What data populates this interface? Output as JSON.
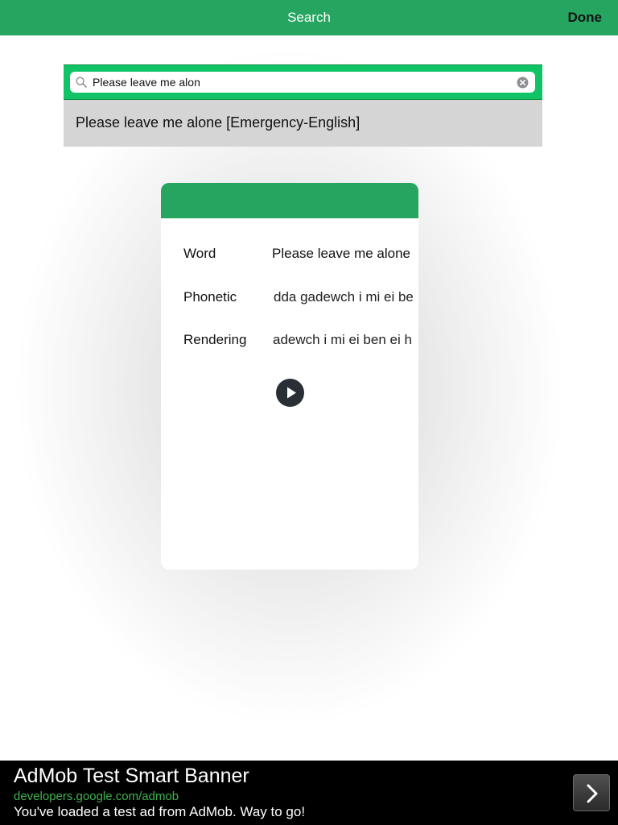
{
  "navbar": {
    "title": "Search",
    "done_label": "Done",
    "color": "#26a560"
  },
  "search": {
    "value": "Please leave me alon",
    "icon": "search-icon",
    "clear_icon": "clear-icon",
    "accent": "#10c465"
  },
  "suggestion": {
    "text": "Please leave me alone [Emergency-English]"
  },
  "card": {
    "rows": [
      {
        "label": "Word",
        "value": "Please leave me alone"
      },
      {
        "label": "Phonetic",
        "value": "dda gadewch i mi ei be"
      },
      {
        "label": "Rendering",
        "value": "adewch i mi ei ben ei h"
      }
    ],
    "play_icon": "play-icon"
  },
  "ad": {
    "title": "AdMob Test Smart Banner",
    "url": "developers.google.com/admob",
    "description": "You've loaded a test ad from AdMob. Way to go!",
    "arrow_icon": "chevron-right-icon",
    "url_color": "#3fb24f"
  }
}
